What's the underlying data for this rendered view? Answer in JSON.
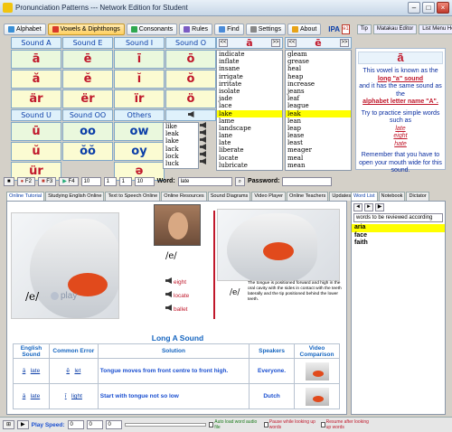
{
  "window": {
    "title": "Pronunciation Patterns --- Network Edition for Student"
  },
  "toolbar": {
    "buttons": [
      {
        "label": "Alphabet",
        "icon": "alphabet-icon"
      },
      {
        "label": "Vowels & Diphthongs",
        "icon": "vowels-icon",
        "active": true
      },
      {
        "label": "Consonants",
        "icon": "consonants-icon"
      },
      {
        "label": "Rules",
        "icon": "rules-icon"
      },
      {
        "label": "Find",
        "icon": "find-icon"
      },
      {
        "label": "Settings",
        "icon": "settings-icon"
      },
      {
        "label": "About",
        "icon": "about-icon"
      }
    ],
    "ipa_label": "IPA",
    "ipa_button": "ɘ1",
    "right_tabs": [
      "Tip",
      "Matakau Editor",
      "List Menu Helper"
    ]
  },
  "sound_grid": {
    "headers": [
      "Sound A",
      "Sound E",
      "Sound I",
      "Sound O"
    ],
    "row1": [
      "ā",
      "ē",
      "ī",
      "ō"
    ],
    "row2": [
      "ă",
      "ĕ",
      "ĭ",
      "ŏ"
    ],
    "row3": [
      "är",
      "ër",
      "ïr",
      "ö"
    ],
    "headers2": [
      "Sound U",
      "Sound OO",
      "Others"
    ],
    "row4": [
      "ū",
      "oo",
      "ow"
    ],
    "row5": [
      "ŭ",
      "ŏŏ",
      "oy"
    ],
    "row6": [
      "ür",
      "ə"
    ]
  },
  "wordlists": {
    "col1_symbol": "ā",
    "col2_symbol": "ē",
    "col1": [
      "indicate",
      "inflate",
      "insane",
      "irrigate",
      "irritate",
      "isolate",
      "jade",
      "lace",
      "lake",
      "lame",
      "landscape",
      "lane",
      "late",
      "liberate",
      "locate",
      "lubricate"
    ],
    "col1_highlight": 8,
    "col2": [
      "gleam",
      "grease",
      "heal",
      "heap",
      "increase",
      "jeans",
      "leaf",
      "league",
      "leak",
      "lean",
      "leap",
      "lease",
      "least",
      "meager",
      "meal",
      "mean"
    ],
    "col2_highlight": 8,
    "col3": [
      "like",
      "leak",
      "lake",
      "lack",
      "lock",
      "luck"
    ]
  },
  "info": {
    "symbol": "ā",
    "text1": "This vowel is known as the",
    "term": "long \"a\" sound",
    "text2": "and it has the same sound as the",
    "term2": "alphabet letter name \"A\".",
    "text3": "Try to practice simple words such as",
    "examples": [
      "late",
      "eight",
      "hate"
    ],
    "text4": "Remember that you have to open your mouth wide for this sound."
  },
  "controls": {
    "f2": "F2",
    "f3": "F3",
    "f4": "F4",
    "zoom1": "10",
    "zoom2": "1",
    "zoom3": "1",
    "zoom4": "10",
    "word_label": "Word:",
    "word_value": "late",
    "password_label": "Password:"
  },
  "tabs": [
    "Online Tutorial",
    "Studying English Online",
    "Text to Speech Online",
    "Online Resources",
    "Sound Diagrams",
    "Video Player",
    "Online Teachers",
    "Updates"
  ],
  "side_tabs": [
    "Word List",
    "Notebook",
    "Dictator"
  ],
  "lesson": {
    "ipa": "/e/",
    "play": "play",
    "ipa_right": "/e/",
    "sound_words": [
      "eight",
      "locate",
      "ballet"
    ],
    "description": "The tongue is positioned forward and high in the oral cavity with the sides in contact with the teeth laterally and the tip positioned behind the lower teeth.",
    "title": "Long A Sound",
    "table_headers": [
      "English Sound",
      "Common Error",
      "Solution",
      "Speakers",
      "Video Comparison"
    ],
    "rows": [
      {
        "sound": "ā",
        "word": "late",
        "error_sound": "ĕ",
        "error_word": "let",
        "solution": "Tongue moves from front centre to front high.",
        "speakers": "Everyone."
      },
      {
        "sound": "ā",
        "word": "late",
        "error_sound": "ĭ",
        "error_word": "light",
        "solution": "Start with tongue not so low",
        "speakers": "Dutch"
      }
    ]
  },
  "sidebar": {
    "dropdown": "words to be reviewed according",
    "words": [
      "aria",
      "face",
      "faith"
    ],
    "highlight": 0
  },
  "status": {
    "play_speed": "Play Speed:",
    "speed1": "0",
    "speed2": "0",
    "speed3": "0",
    "auto_load": "Auto load word audio file",
    "pause": "Pause while looking up words",
    "resume": "Resume after looking up words"
  },
  "colors": {
    "accent_red": "#c0182b",
    "accent_blue": "#0b3ea8",
    "highlight": "#ffff00"
  }
}
